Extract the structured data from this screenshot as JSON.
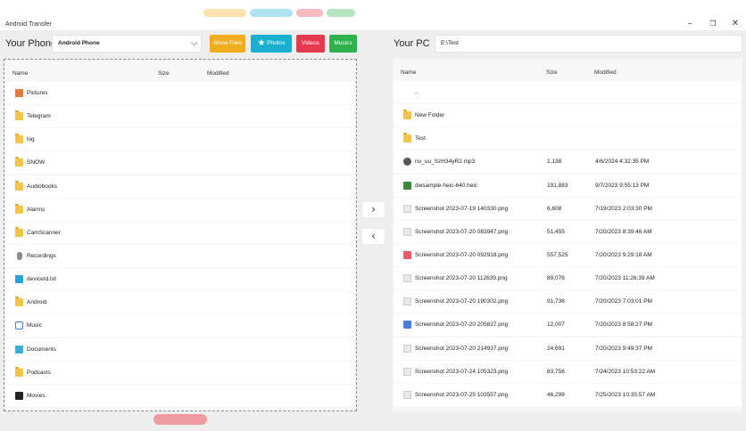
{
  "app": {
    "title": "Android Transfer"
  },
  "window_controls": {
    "minimize": "–",
    "restore": "❐",
    "close": "✕"
  },
  "phone": {
    "label": "Your Phone",
    "device": "Android Phone",
    "buttons": [
      {
        "label": "Show Files",
        "color": "#f0ad1e"
      },
      {
        "label": "Photos",
        "color": "#19b0d0"
      },
      {
        "label": "Videos",
        "color": "#e53950"
      },
      {
        "label": "Musics",
        "color": "#2fb24e"
      }
    ],
    "columns": {
      "name": "Name",
      "size": "Size",
      "modified": "Modified"
    },
    "items": [
      {
        "name": "Pictures",
        "icon": "pictures-folder-icon"
      },
      {
        "name": "Telegram",
        "icon": "folder-icon"
      },
      {
        "name": "log",
        "icon": "folder-icon"
      },
      {
        "name": "SNOW",
        "icon": "folder-icon"
      },
      {
        "name": "Audiobooks",
        "icon": "folder-icon"
      },
      {
        "name": "Alarms",
        "icon": "folder-icon"
      },
      {
        "name": "CamScanner",
        "icon": "folder-icon"
      },
      {
        "name": "Recordings",
        "icon": "microphone-icon"
      },
      {
        "name": "deviceId.txt",
        "icon": "text-file-icon"
      },
      {
        "name": "Android",
        "icon": "folder-icon"
      },
      {
        "name": "Music",
        "icon": "music-folder-icon"
      },
      {
        "name": "Documents",
        "icon": "documents-folder-icon"
      },
      {
        "name": "Podcasts",
        "icon": "folder-icon"
      },
      {
        "name": "Movies",
        "icon": "movies-folder-icon"
      }
    ]
  },
  "pc": {
    "label": "Your PC",
    "path": "E:\\Test",
    "columns": {
      "name": "Name",
      "size": "Size",
      "modified": "Modified"
    },
    "items": [
      {
        "name": "..",
        "size": "",
        "modified": "",
        "icon": "parent-dir-icon"
      },
      {
        "name": "New Folder",
        "size": "",
        "modified": "",
        "icon": "folder-icon"
      },
      {
        "name": "Test",
        "size": "",
        "modified": "",
        "icon": "folder-icon"
      },
      {
        "name": "nu_uu_SzH34yR2.mp3",
        "size": "1,138",
        "modified": "4/6/2024 4:32:35 PM",
        "icon": "audio-file-icon"
      },
      {
        "name": "dwsample-heic-640.heic",
        "size": "191,883",
        "modified": "9/7/2023 9:55:13 PM",
        "icon": "image-file-icon"
      },
      {
        "name": "Screenshot 2023-07-19 140330.png",
        "size": "6,608",
        "modified": "7/19/2023 2:03:30 PM",
        "icon": "image-file-icon"
      },
      {
        "name": "Screenshot 2023-07-20 083947.png",
        "size": "51,455",
        "modified": "7/20/2023 8:39:46 AM",
        "icon": "image-file-icon"
      },
      {
        "name": "Screenshot 2023-07-20 092918.png",
        "size": "557,525",
        "modified": "7/20/2023 9:29:18 AM",
        "icon": "image-file-icon"
      },
      {
        "name": "Screenshot 2023-07-20 112639.png",
        "size": "89,076",
        "modified": "7/20/2023 11:26:39 AM",
        "icon": "image-file-icon"
      },
      {
        "name": "Screenshot 2023-07-20 190302.png",
        "size": "91,736",
        "modified": "7/20/2023 7:03:01 PM",
        "icon": "image-file-icon"
      },
      {
        "name": "Screenshot 2023-07-20 205827.png",
        "size": "12,007",
        "modified": "7/20/2023 8:58:27 PM",
        "icon": "image-file-icon"
      },
      {
        "name": "Screenshot 2023-07-20 214937.png",
        "size": "24,691",
        "modified": "7/20/2023 9:49:37 PM",
        "icon": "image-file-icon"
      },
      {
        "name": "Screenshot 2023-07-24 105323.png",
        "size": "83,756",
        "modified": "7/24/2023 10:53:22 AM",
        "icon": "image-file-icon"
      },
      {
        "name": "Screenshot 2023-07-25 103557.png",
        "size": "46,299",
        "modified": "7/25/2023 10:35:57 AM",
        "icon": "image-file-icon"
      }
    ]
  },
  "transfer": {
    "to_pc": "›",
    "to_phone": "‹"
  }
}
